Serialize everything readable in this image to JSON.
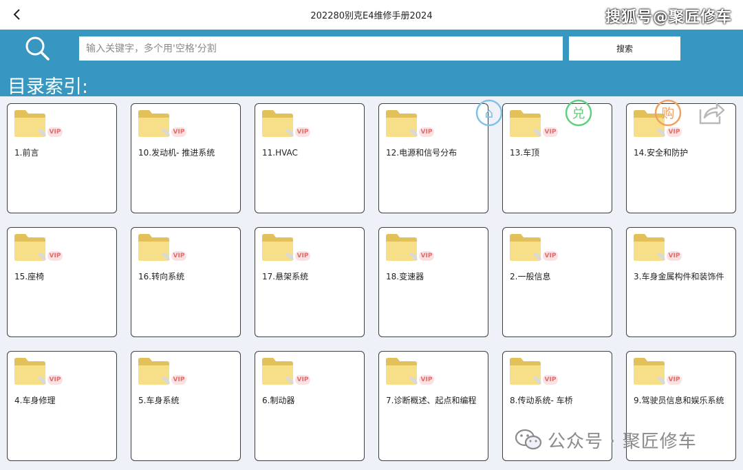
{
  "topbar": {
    "title": "202280别克E4维修手册2024",
    "back_icon": "chevron-left-icon",
    "watermark": "搜狐号@聚匠修车"
  },
  "search": {
    "placeholder": "输入关键字，多个用'空格'分割",
    "value": "",
    "button_label": "搜索",
    "icon": "search-icon"
  },
  "index": {
    "title": "目录索引:"
  },
  "float_icons": {
    "home": "⌂",
    "redeem": "兑",
    "buy": "购",
    "share_icon": "share-icon"
  },
  "badge_label": "VIP",
  "items": [
    {
      "label": "1.前言"
    },
    {
      "label": "10.发动机- 推进系统"
    },
    {
      "label": "11.HVAC"
    },
    {
      "label": "12.电源和信号分布"
    },
    {
      "label": "13.车顶"
    },
    {
      "label": "14.安全和防护"
    },
    {
      "label": "15.座椅"
    },
    {
      "label": "16.转向系统"
    },
    {
      "label": "17.悬架系统"
    },
    {
      "label": "18.变速器"
    },
    {
      "label": "2.一般信息"
    },
    {
      "label": "3.车身金属构件和装饰件"
    },
    {
      "label": "4.车身修理"
    },
    {
      "label": "5.车身系统"
    },
    {
      "label": "6.制动器"
    },
    {
      "label": "7.诊断概述、起点和编程"
    },
    {
      "label": "8.传动系统- 车桥"
    },
    {
      "label": "9.驾驶员信息和娱乐系统"
    }
  ],
  "watermark_bottom": {
    "text": "公众号 · 聚匠修车",
    "icon": "wechat-icon"
  },
  "colors": {
    "accent": "#3797c0",
    "card_border": "#3d3d3d",
    "vip_bg": "#fbe1e1",
    "vip_text": "#e46b6b",
    "home_icon": "#7fc2e6",
    "redeem_icon": "#5cd07a",
    "buy_icon": "#f0a060"
  }
}
